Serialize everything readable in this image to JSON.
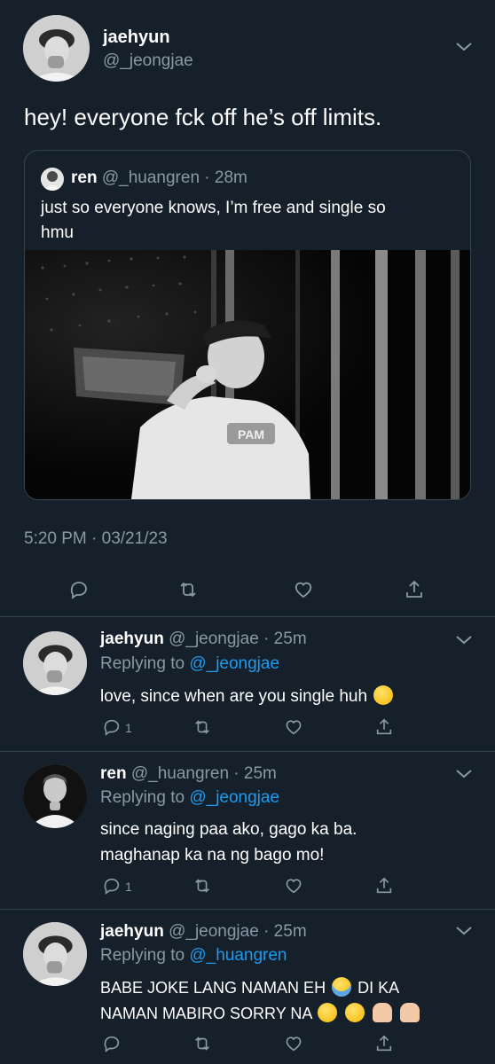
{
  "main_tweet": {
    "name": "jaehyun",
    "handle": "@_jeongjae",
    "text": "hey! everyone fck off he’s off limits.",
    "timestamp": "5:20 PM · 03/21/23",
    "quoted": {
      "name": "ren",
      "handle": "@_huangren",
      "time": "· 28m",
      "text_line1": "just so everyone knows, I’m free and single so",
      "text_line2": "hmu",
      "photo_lettering": "PAM"
    }
  },
  "replies": [
    {
      "name": "jaehyun",
      "handle": "@_jeongjae",
      "time": "· 25m",
      "replying_prefix": "Replying to",
      "replying_to": "@_jeongjae",
      "line1": "love, since when are you single huh",
      "emoji": "weary-face",
      "reply_count": "1"
    },
    {
      "name": "ren",
      "handle": "@_huangren",
      "time": "· 25m",
      "replying_prefix": "Replying to",
      "replying_to": "@_jeongjae",
      "line1": "since naging paa ako, gago ka ba.",
      "line2": "maghanap ka na ng bago mo!",
      "reply_count": "1"
    },
    {
      "name": "jaehyun",
      "handle": "@_jeongjae",
      "time": "· 25m",
      "replying_prefix": "Replying to",
      "replying_to": "@_huangren",
      "line1": "BABE JOKE LANG NAMAN EH",
      "line1_b": "DI KA",
      "line2": "NAMAN MABIRO SORRY NA",
      "emojis": [
        "loudly-crying-face",
        "pleading-face",
        "pleading-face",
        "folded-hands",
        "folded-hands"
      ]
    }
  ],
  "icons": [
    "reply-icon",
    "retweet-icon",
    "like-icon",
    "share-icon",
    "chevron-down-icon"
  ],
  "colors": {
    "background": "#15202b",
    "muted": "#8b98a5",
    "link": "#1d9bf0",
    "divider": "#38444d"
  }
}
